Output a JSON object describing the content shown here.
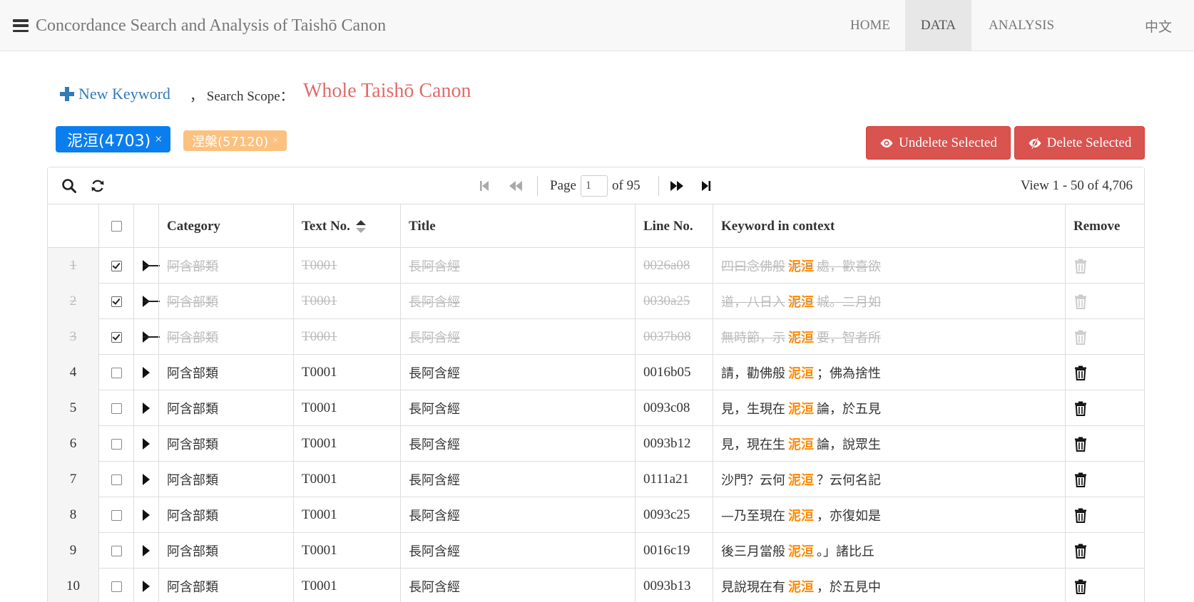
{
  "nav": {
    "brand": "Concordance Search and Analysis of Taishō Canon",
    "home": "HOME",
    "data": "DATA",
    "analysis": "ANALYSIS",
    "lang": "中文"
  },
  "toolbar": {
    "new_keyword": "New Keyword",
    "scope_label": "， Search Scope：",
    "scope_value": "Whole Taishō Canon"
  },
  "keywords": [
    {
      "label": "泥洹(4703)",
      "close": "×",
      "active": true
    },
    {
      "label": "涅槃(57120)",
      "close": "×",
      "active": false
    }
  ],
  "actions": {
    "undelete": "Undelete Selected",
    "delete": "Delete Selected"
  },
  "pager": {
    "page_label": "Page",
    "page_value": "1",
    "of_label": "of 95",
    "view_info": "View 1 - 50 of 4,706"
  },
  "columns": [
    "Category",
    "Text No.",
    "Title",
    "Line No.",
    "Keyword in context",
    "Remove"
  ],
  "rows": [
    {
      "n": "1",
      "checked": true,
      "deleted": true,
      "category": "阿含部類",
      "text_no": "T0001",
      "title": "長阿含經",
      "line_no": "0026a08",
      "pre": "四曰念佛般",
      "kw": "泥洹",
      "post": "處，歡喜欲"
    },
    {
      "n": "2",
      "checked": true,
      "deleted": true,
      "category": "阿含部類",
      "text_no": "T0001",
      "title": "長阿含經",
      "line_no": "0030a25",
      "pre": "道，八日入",
      "kw": "泥洹",
      "post": "城。二月如"
    },
    {
      "n": "3",
      "checked": true,
      "deleted": true,
      "category": "阿含部類",
      "text_no": "T0001",
      "title": "長阿含經",
      "line_no": "0037b08",
      "pre": "無時節，示",
      "kw": "泥洹",
      "post": "要，智者所"
    },
    {
      "n": "4",
      "checked": false,
      "deleted": false,
      "category": "阿含部類",
      "text_no": "T0001",
      "title": "長阿含經",
      "line_no": "0016b05",
      "pre": "請，勸佛般",
      "kw": "泥洹",
      "post": "；佛為捨性"
    },
    {
      "n": "5",
      "checked": false,
      "deleted": false,
      "category": "阿含部類",
      "text_no": "T0001",
      "title": "長阿含經",
      "line_no": "0093c08",
      "pre": "見，生現在",
      "kw": "泥洹",
      "post": "論，於五見"
    },
    {
      "n": "6",
      "checked": false,
      "deleted": false,
      "category": "阿含部類",
      "text_no": "T0001",
      "title": "長阿含經",
      "line_no": "0093b12",
      "pre": "見，現在生",
      "kw": "泥洹",
      "post": "論，說眾生"
    },
    {
      "n": "7",
      "checked": false,
      "deleted": false,
      "category": "阿含部類",
      "text_no": "T0001",
      "title": "長阿含經",
      "line_no": "0111a21",
      "pre": "沙門？云何",
      "kw": "泥洹",
      "post": "？云何名記"
    },
    {
      "n": "8",
      "checked": false,
      "deleted": false,
      "category": "阿含部類",
      "text_no": "T0001",
      "title": "長阿含經",
      "line_no": "0093c25",
      "pre": "—乃至現在",
      "kw": "泥洹",
      "post": "，亦復如是"
    },
    {
      "n": "9",
      "checked": false,
      "deleted": false,
      "category": "阿含部類",
      "text_no": "T0001",
      "title": "長阿含經",
      "line_no": "0016c19",
      "pre": "後三月當般",
      "kw": "泥洹",
      "post": "。」諸比丘"
    },
    {
      "n": "10",
      "checked": false,
      "deleted": false,
      "category": "阿含部類",
      "text_no": "T0001",
      "title": "長阿含經",
      "line_no": "0093b13",
      "pre": "見說現在有",
      "kw": "泥洹",
      "post": "，於五見中"
    }
  ],
  "colors": {
    "primary_tag": "#0b7eef",
    "secondary_tag": "#fcc17f",
    "danger": "#d9534f",
    "keyword_highlight": "#ff8800",
    "scope": "#e06b6b"
  }
}
